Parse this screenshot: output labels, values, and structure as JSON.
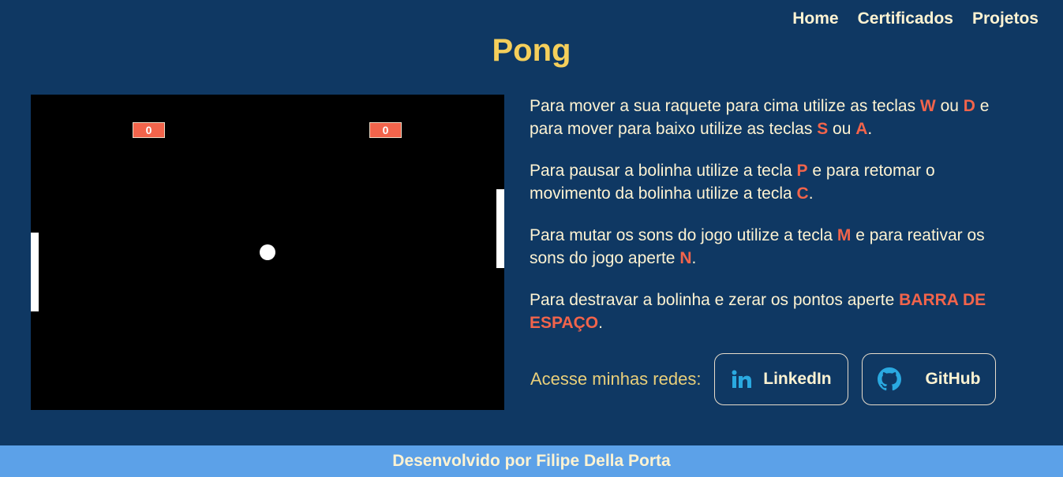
{
  "nav": {
    "items": [
      {
        "label": "Home"
      },
      {
        "label": "Certificados"
      },
      {
        "label": "Projetos"
      }
    ]
  },
  "page_title": "Pong",
  "game": {
    "score_left": "0",
    "score_right": "0"
  },
  "instructions": [
    {
      "parts": [
        "Para mover a sua raquete para cima utilize as teclas ",
        "W",
        " ou ",
        "D",
        " e para mover para baixo utilize as teclas ",
        "S",
        " ou ",
        "A",
        "."
      ]
    },
    {
      "parts": [
        "Para pausar a bolinha utilize a tecla ",
        "P",
        " e para retomar o movimento da bolinha utilize a tecla ",
        "C",
        "."
      ]
    },
    {
      "parts": [
        "Para mutar os sons do jogo utilize a tecla ",
        "M",
        " e para reativar os sons do jogo aperte ",
        "N",
        "."
      ]
    },
    {
      "parts": [
        "Para destravar a bolinha e zerar os pontos aperte ",
        "BARRA DE ESPAÇO",
        "."
      ]
    }
  ],
  "social": {
    "label": "Acesse minhas redes:",
    "linkedin_label": "LinkedIn",
    "github_label": "GitHub",
    "linkedin_icon": "linkedin-icon",
    "github_icon": "github-icon"
  },
  "footer": {
    "text": "Desenvolvido por Filipe Della Porta"
  },
  "colors": {
    "background": "#0f3863",
    "title": "#f5cf5b",
    "key_highlight": "#f2644b",
    "footer": "#5ca1e8",
    "linkedin_icon": "#2aa9e0"
  }
}
